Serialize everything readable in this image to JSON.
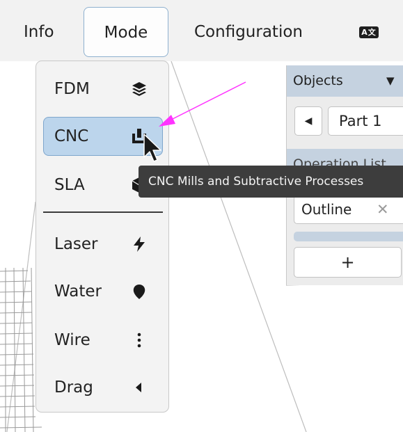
{
  "topbar": {
    "items": [
      {
        "label": "Info"
      },
      {
        "label": "Mode"
      },
      {
        "label": "Configuration"
      }
    ],
    "lang_icon": "language-icon",
    "lang_text": "A文"
  },
  "mode_menu": {
    "items": [
      {
        "label": "FDM",
        "icon": "layers-icon"
      },
      {
        "label": "CNC",
        "icon": "cnc-mill-icon",
        "selected": true
      },
      {
        "label": "SLA",
        "icon": "cube-icon"
      },
      {
        "label": "Laser",
        "icon": "bolt-icon"
      },
      {
        "label": "Water",
        "icon": "droplet-icon"
      },
      {
        "label": "Wire",
        "icon": "vertical-dots-icon"
      },
      {
        "label": "Drag",
        "icon": "caret-left-icon"
      }
    ]
  },
  "tooltip": {
    "text": "CNC Mills and Subtractive Processes"
  },
  "objects_panel": {
    "title": "Objects",
    "caret": "▼",
    "prev": "◀",
    "part_label": "Part 1"
  },
  "operation_panel": {
    "title": "Operation List",
    "items": [
      {
        "label": "Outline",
        "remove": "✕"
      }
    ],
    "add_label": "+"
  },
  "colors": {
    "selected_bg": "#bcd5ec",
    "panel_header": "#c5d2e0",
    "tooltip_bg": "#3d3d3d",
    "annotation_arrow": "#ff33ff"
  }
}
